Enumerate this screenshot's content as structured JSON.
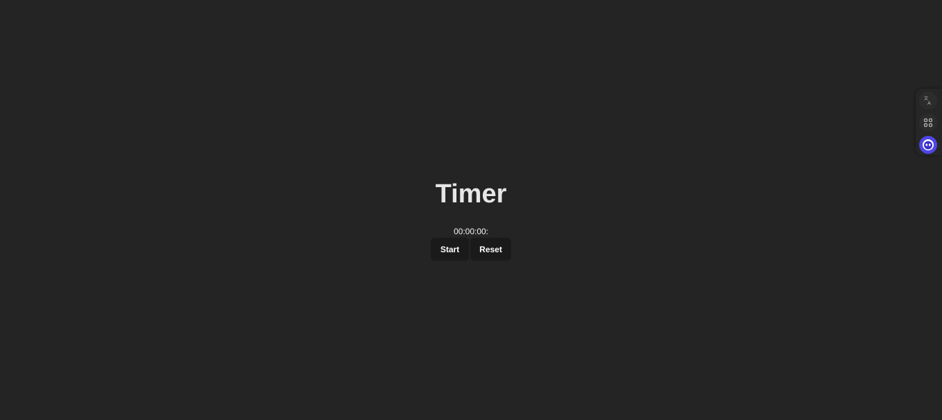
{
  "timer": {
    "title": "Timer",
    "readout": "00:00:00:",
    "start_label": "Start",
    "reset_label": "Reset"
  },
  "side_dock": {
    "items": [
      {
        "icon": "translate-icon"
      },
      {
        "icon": "apps-grid-icon"
      },
      {
        "icon": "assistant-avatar-icon"
      }
    ]
  },
  "colors": {
    "background": "#242424",
    "button_bg": "#1a1a1a",
    "title_text": "#e6e6e6",
    "assistant_accent": "#4f46e5"
  }
}
